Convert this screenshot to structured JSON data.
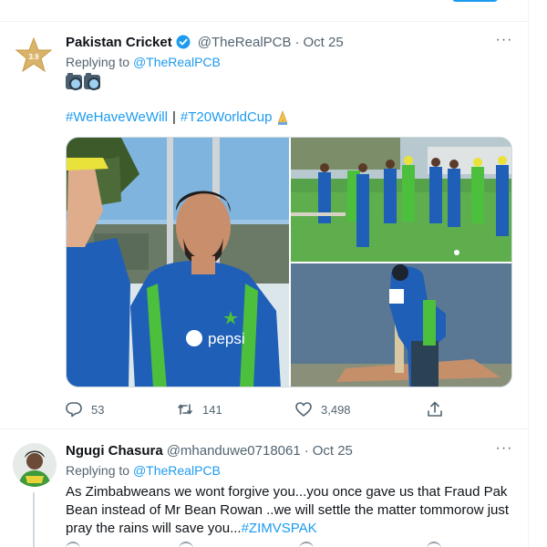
{
  "tweets": [
    {
      "author_name": "Pakistan Cricket",
      "handle": "@TheRealPCB",
      "separator": "·",
      "date": "Oct 25",
      "replying_label": "Replying to",
      "replying_to": "@TheRealPCB",
      "hashtags": [
        "#WeHaveWeWill",
        "#T20WorldCup"
      ],
      "hashtag_separator": "|",
      "more_label": "···",
      "avatar_text": "3.9",
      "stats": {
        "replies": "53",
        "retweets": "141",
        "likes": "3,498"
      },
      "image_jersey_text": "pepsi"
    },
    {
      "author_name": "Ngugi Chasura",
      "handle": "@mhanduwe0718061",
      "separator": "·",
      "date": "Oct 25",
      "replying_label": "Replying to",
      "replying_to": "@TheRealPCB",
      "more_label": "···",
      "body_text": "As Zimbabweans we wont forgive you...you once gave us that Fraud Pak Bean instead of Mr Bean Rowan ..we will settle the matter tommorow just pray the rains will save you...",
      "body_hashtag": "#ZIMVSPAK"
    }
  ],
  "colors": {
    "accent": "#1d9bf0",
    "verified": "#1d9bf0",
    "muted": "#536471",
    "text": "#0f1419",
    "kit_blue": "#1f5fb8",
    "kit_green": "#4cbf3c"
  }
}
